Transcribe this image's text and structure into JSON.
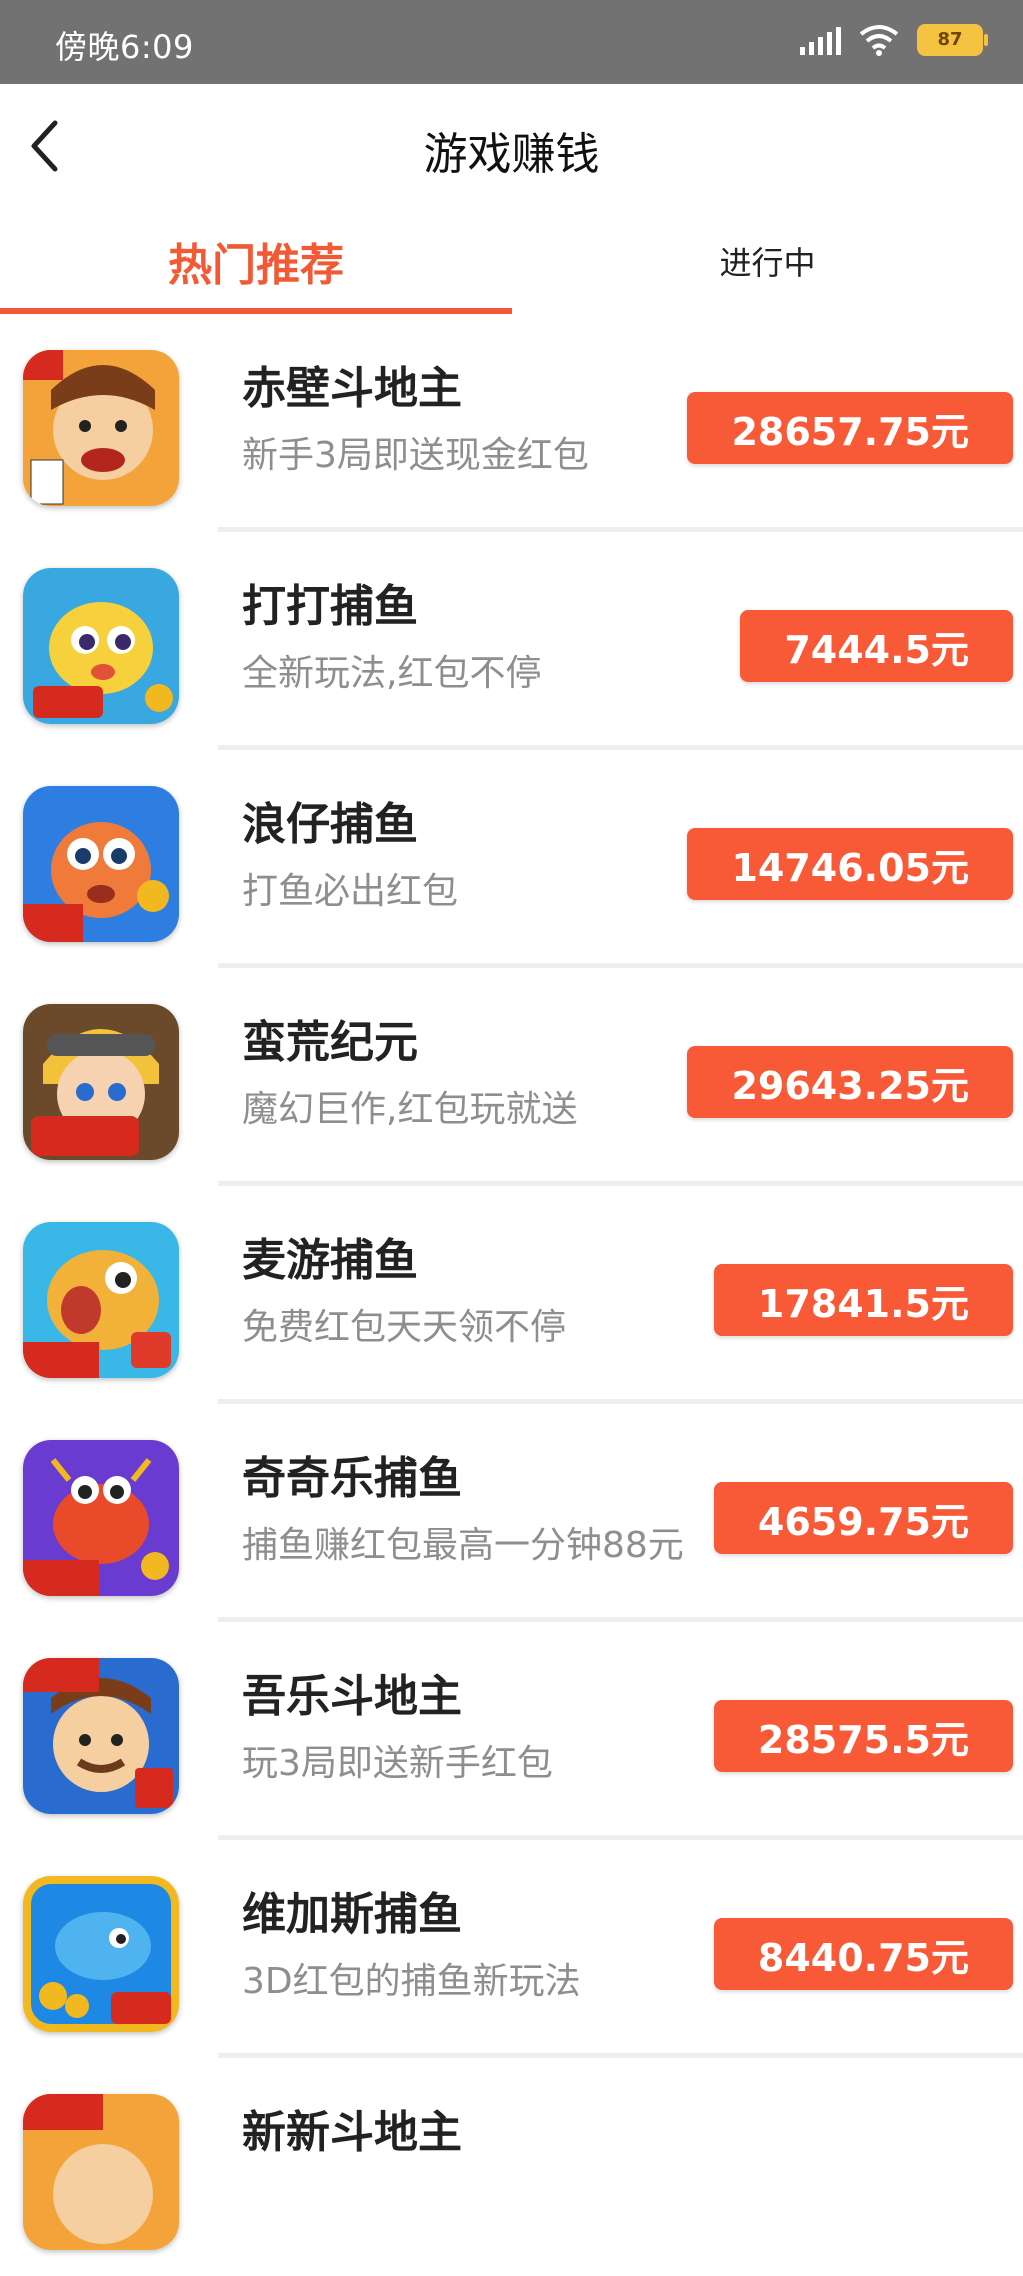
{
  "status_bar": {
    "time": "傍晚6:09",
    "battery": "87"
  },
  "header": {
    "title": "游戏赚钱"
  },
  "tabs": [
    {
      "label": "热门推荐",
      "active": true
    },
    {
      "label": "进行中",
      "active": false
    }
  ],
  "games": [
    {
      "name": "赤壁斗地主",
      "desc": "新手3局即送现金红包",
      "reward": "28657.75元",
      "icon": "game-icon"
    },
    {
      "name": "打打捕鱼",
      "desc": "全新玩法,红包不停",
      "reward": "7444.5元",
      "icon": "game-icon"
    },
    {
      "name": "浪仔捕鱼",
      "desc": "打鱼必出红包",
      "reward": "14746.05元",
      "icon": "game-icon"
    },
    {
      "name": "蛮荒纪元",
      "desc": "魔幻巨作,红包玩就送",
      "reward": "29643.25元",
      "icon": "game-icon"
    },
    {
      "name": "麦游捕鱼",
      "desc": "免费红包天天领不停",
      "reward": "17841.5元",
      "icon": "game-icon"
    },
    {
      "name": "奇奇乐捕鱼",
      "desc": "捕鱼赚红包最高一分钟88元",
      "reward": "4659.75元",
      "icon": "game-icon"
    },
    {
      "name": "吾乐斗地主",
      "desc": "玩3局即送新手红包",
      "reward": "28575.5元",
      "icon": "game-icon"
    },
    {
      "name": "维加斯捕鱼",
      "desc": "3D红包的捕鱼新玩法",
      "reward": "8440.75元",
      "icon": "game-icon"
    },
    {
      "name": "新新斗地主",
      "desc": "",
      "reward": "",
      "icon": "game-icon"
    }
  ],
  "colors": {
    "accent": "#f15a34",
    "button": "#f85a38",
    "statusbar": "#727272"
  }
}
